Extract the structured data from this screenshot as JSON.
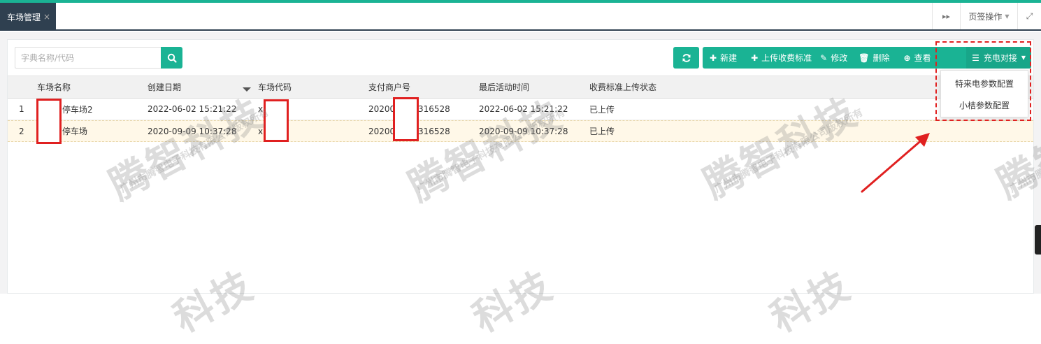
{
  "tabs": {
    "active_label": "车场管理",
    "close_glyph": "×",
    "forward_glyph": "▸▸",
    "page_ops_label": "页签操作",
    "fullscreen_glyph": "⤢"
  },
  "search": {
    "placeholder": "字典名称/代码"
  },
  "toolbar": {
    "new": "新建",
    "upload_fee": "上传收费标准",
    "edit": "修改",
    "delete": "删除",
    "view": "查看",
    "charge_dock": "充电对接"
  },
  "dropdown": {
    "items": [
      "特来电参数配置",
      "小桔参数配置"
    ]
  },
  "table": {
    "headers": [
      "车场名称",
      "创建日期",
      "车场代码",
      "支付商户号",
      "最后活动时间",
      "收费标准上传状态"
    ],
    "rows": [
      {
        "index": "1",
        "name": "停车场2",
        "created": "2022-06-02 15:21:22",
        "code": "x",
        "merchant_a": "20200",
        "merchant_b": "316528",
        "last_active": "2022-06-02 15:21:22",
        "status": "已上传"
      },
      {
        "index": "2",
        "name": "停车场",
        "created": "2020-09-09 10:37:28",
        "code": "x",
        "merchant_a": "20200",
        "merchant_b": "316528",
        "last_active": "2020-09-09 10:37:28",
        "status": "已上传"
      }
    ]
  },
  "watermark": {
    "big": "腾智科技",
    "small": "广州市腾智电子科技有限公司版权所有",
    "partial": "科技"
  },
  "colors": {
    "accent": "#1ab394",
    "dark_tab": "#2f4050",
    "annotation_red": "#e02020"
  }
}
